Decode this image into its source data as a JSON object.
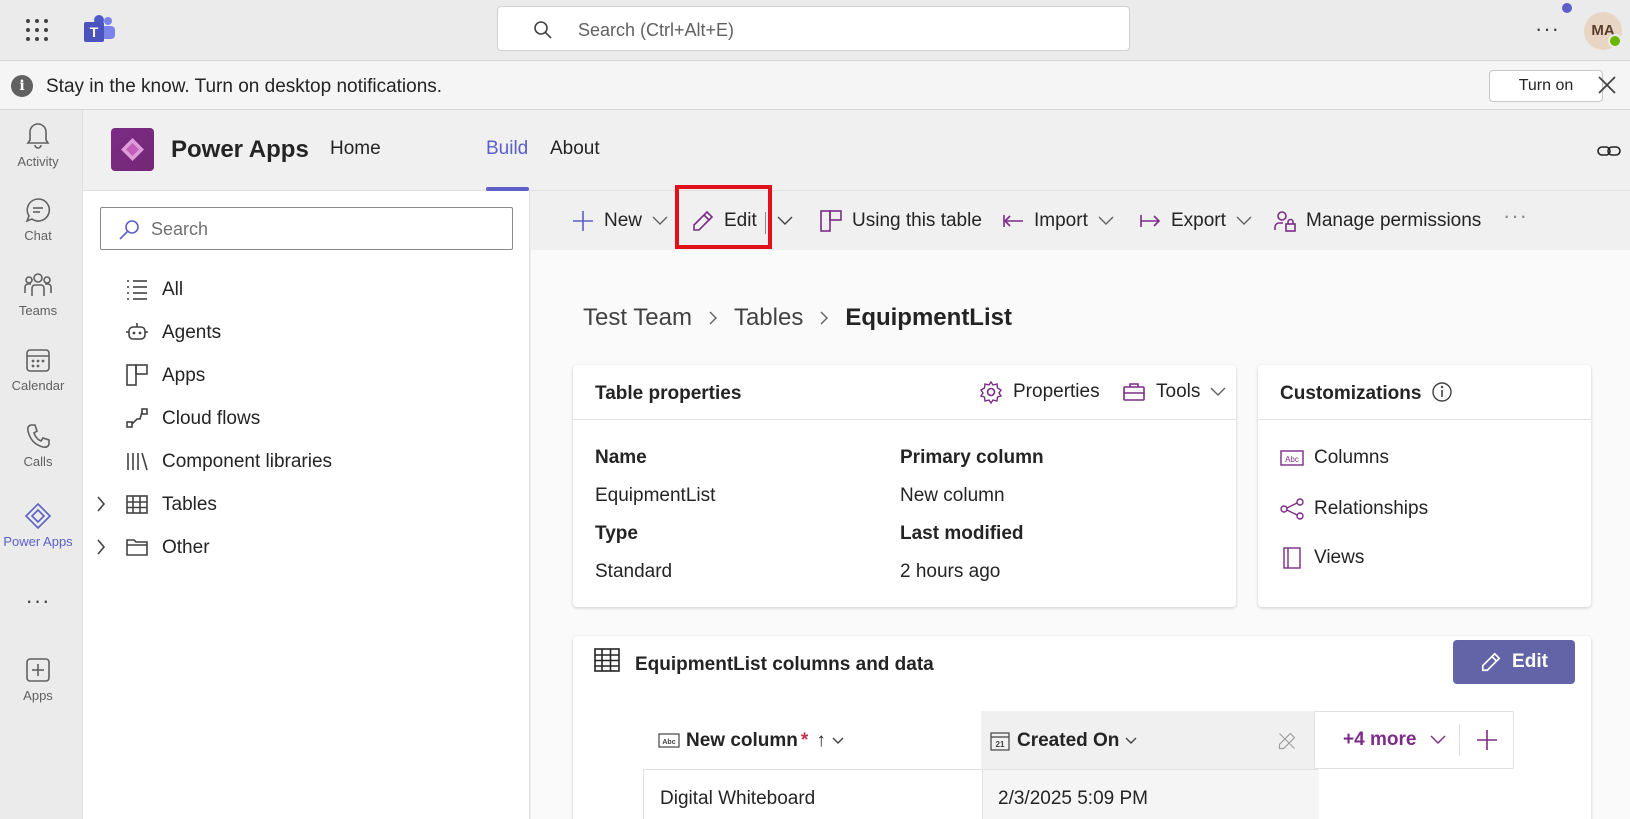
{
  "topbar": {
    "search_placeholder": "Search (Ctrl+Alt+E)",
    "more_label": "···",
    "avatar_initials": "MA"
  },
  "banner": {
    "info_glyph": "i",
    "message": "Stay in the know. Turn on desktop notifications.",
    "turn_on_label": "Turn on"
  },
  "rail": {
    "items": [
      {
        "label": "Activity",
        "icon": "bell-icon"
      },
      {
        "label": "Chat",
        "icon": "chat-icon"
      },
      {
        "label": "Teams",
        "icon": "teams-icon"
      },
      {
        "label": "Calendar",
        "icon": "calendar-icon"
      },
      {
        "label": "Calls",
        "icon": "phone-icon"
      },
      {
        "label": "Power Apps",
        "icon": "power-apps-icon",
        "active": true
      },
      {
        "label": "Apps",
        "icon": "add-app-icon"
      }
    ],
    "more_label": "···"
  },
  "app": {
    "title": "Power Apps",
    "tabs": [
      {
        "label": "Home"
      },
      {
        "label": "Build",
        "active": true
      },
      {
        "label": "About"
      }
    ]
  },
  "nav": {
    "search_placeholder": "Search",
    "items": [
      {
        "label": "All",
        "icon": "list-icon"
      },
      {
        "label": "Agents",
        "icon": "bot-icon"
      },
      {
        "label": "Apps",
        "icon": "apps-grid-icon"
      },
      {
        "label": "Cloud flows",
        "icon": "flow-icon"
      },
      {
        "label": "Component libraries",
        "icon": "library-icon"
      },
      {
        "label": "Tables",
        "icon": "table-icon",
        "expandable": true
      },
      {
        "label": "Other",
        "icon": "folder-icon",
        "expandable": true
      }
    ]
  },
  "commandbar": {
    "new_label": "New",
    "edit_label": "Edit",
    "using_table_label": "Using this table",
    "import_label": "Import",
    "export_label": "Export",
    "manage_permissions_label": "Manage permissions",
    "more_label": "···"
  },
  "breadcrumb": {
    "items": [
      "Test Team",
      "Tables"
    ],
    "current": "EquipmentList"
  },
  "table_properties": {
    "title": "Table properties",
    "properties_label": "Properties",
    "tools_label": "Tools",
    "name_label": "Name",
    "name_value": "EquipmentList",
    "primary_column_label": "Primary column",
    "primary_column_value": "New column",
    "type_label": "Type",
    "type_value": "Standard",
    "last_modified_label": "Last modified",
    "last_modified_value": "2 hours ago"
  },
  "customizations": {
    "title": "Customizations",
    "items": [
      {
        "label": "Columns",
        "icon": "abc-column-icon"
      },
      {
        "label": "Relationships",
        "icon": "relationship-icon"
      },
      {
        "label": "Views",
        "icon": "view-icon"
      }
    ]
  },
  "data_section": {
    "title": "EquipmentList columns and data",
    "edit_label": "Edit",
    "columns": [
      {
        "label": "New column",
        "required": "*",
        "sort": "↑"
      },
      {
        "label": "Created On"
      }
    ],
    "more_columns_label": "+4 more",
    "rows": [
      {
        "new_column": "Digital Whiteboard",
        "created_on": "2/3/2025 5:09 PM"
      }
    ]
  },
  "colors": {
    "accent": "#5b5fc7",
    "powerapps_purple": "#742774",
    "edit_button": "#6264a7",
    "highlight_red": "#e0111a"
  }
}
